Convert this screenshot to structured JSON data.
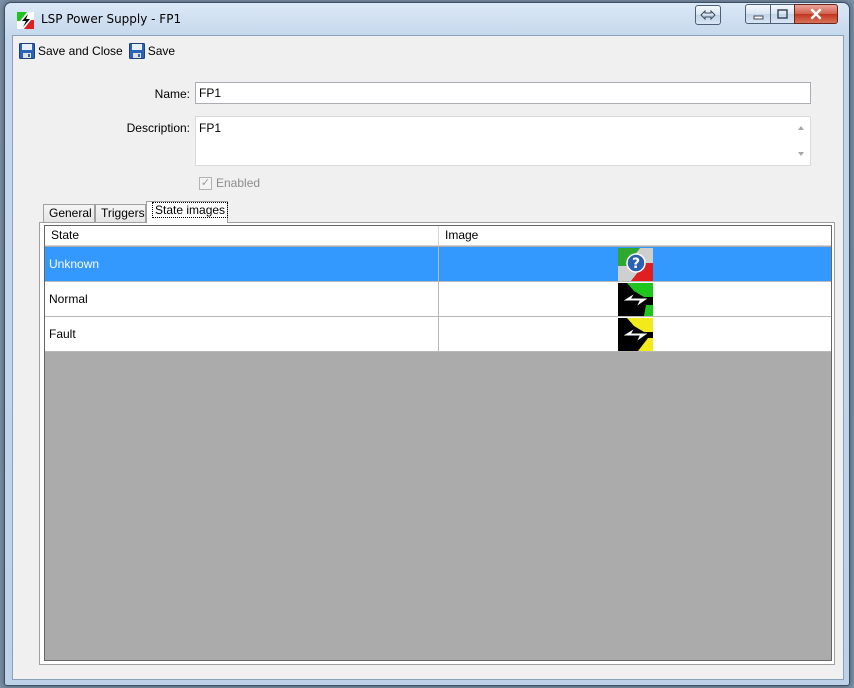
{
  "window": {
    "title": "LSP Power Supply  -  FP1"
  },
  "toolbar": {
    "save_close_label": "Save and Close",
    "save_label": "Save"
  },
  "form": {
    "name_label": "Name:",
    "name_value": "FP1",
    "description_label": "Description:",
    "description_value": "FP1",
    "enabled_label": "Enabled",
    "enabled_checked": true
  },
  "tabs": [
    {
      "label": "General",
      "active": false
    },
    {
      "label": "Triggers",
      "active": false
    },
    {
      "label": "State images",
      "active": true
    }
  ],
  "grid": {
    "columns": [
      "State",
      "Image"
    ],
    "rows": [
      {
        "state": "Unknown",
        "icon": "unknown-state-icon",
        "selected": true
      },
      {
        "state": "Normal",
        "icon": "normal-state-icon",
        "selected": false
      },
      {
        "state": "Fault",
        "icon": "fault-state-icon",
        "selected": false
      }
    ]
  },
  "colors": {
    "selection": "#3399ff",
    "grid_empty": "#ababab",
    "normal_green": "#1fc41f",
    "fault_yellow": "#f2ea1a",
    "unknown_red": "#e02020"
  }
}
